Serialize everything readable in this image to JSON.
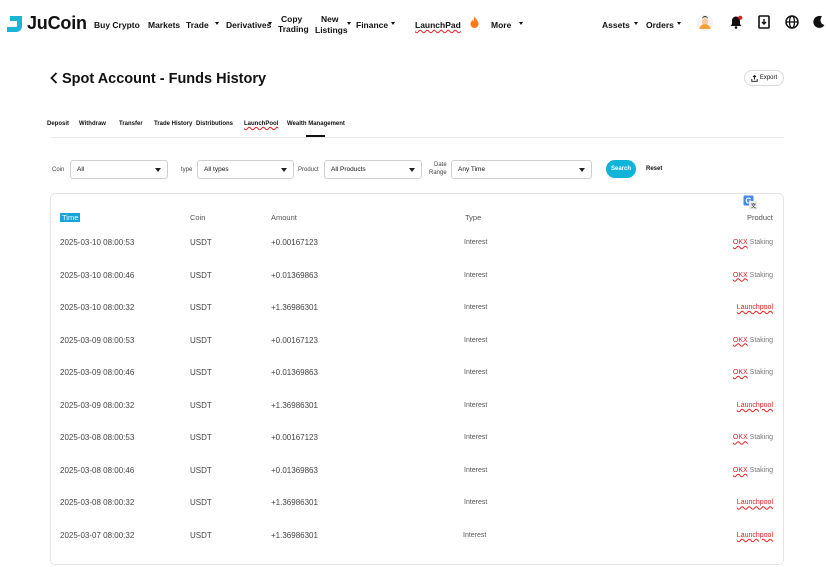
{
  "header": {
    "brand": "JuCoin",
    "nav": {
      "buy_crypto": "Buy Crypto",
      "markets": "Markets",
      "trade": "Trade",
      "derivatives": "Derivatives",
      "copy_trading_1": "Copy",
      "copy_trading_2": "Trading",
      "new_listings_1": "New",
      "new_listings_2": "Listings",
      "finance": "Finance",
      "launchpad": "LaunchPad",
      "more": "More",
      "assets": "Assets",
      "orders": "Orders"
    },
    "icons": [
      "avatar",
      "bell-icon",
      "download-icon",
      "globe-icon",
      "moon-icon"
    ]
  },
  "title": {
    "text": "Spot Account  - Funds History",
    "export_label": "Export"
  },
  "tabs": [
    "Deposit",
    "Withdraw",
    "Transfer",
    "Trade History",
    "Distributions",
    "LaunchPool",
    "Wealth Management"
  ],
  "active_tab": "Wealth Management",
  "filters": {
    "coin_label": "Coin",
    "coin_value": "All",
    "type_label": "type",
    "type_value": "All types",
    "product_label": "Product",
    "product_value": "All Products",
    "date_label_1": "Date",
    "date_label_2": "Range",
    "date_value": "Any Time",
    "search_label": "Search",
    "reset_label": "Reset"
  },
  "table": {
    "columns": {
      "time": "Time",
      "coin": "Coin",
      "amount": "Amount",
      "type": "Type",
      "product": "Product"
    },
    "rows": [
      {
        "time": "2025-03-10 08:00:53",
        "coin": "USDT",
        "amount": "+0.00167123",
        "type": "Interest",
        "product_prefix": "OKX",
        "product": "Staking",
        "launch": false
      },
      {
        "time": "2025-03-10 08:00:46",
        "coin": "USDT",
        "amount": "+0.01369863",
        "type": "Interest",
        "product_prefix": "OKX",
        "product": "Staking",
        "launch": false
      },
      {
        "time": "2025-03-10 08:00:32",
        "coin": "USDT",
        "amount": "+1.36986301",
        "type": "Interest",
        "product_prefix": "",
        "product": "Launchpool",
        "launch": true
      },
      {
        "time": "2025-03-09 08:00:53",
        "coin": "USDT",
        "amount": "+0.00167123",
        "type": "Interest",
        "product_prefix": "OKX",
        "product": "Staking",
        "launch": false
      },
      {
        "time": "2025-03-09 08:00:46",
        "coin": "USDT",
        "amount": "+0.01369863",
        "type": "Interest",
        "product_prefix": "OKX",
        "product": "Staking",
        "launch": false
      },
      {
        "time": "2025-03-09 08:00:32",
        "coin": "USDT",
        "amount": "+1.36986301",
        "type": "Interest",
        "product_prefix": "",
        "product": "Launchpool",
        "launch": true
      },
      {
        "time": "2025-03-08 08:00:53",
        "coin": "USDT",
        "amount": "+0.00167123",
        "type": "Interest",
        "product_prefix": "OKX",
        "product": "Staking",
        "launch": false
      },
      {
        "time": "2025-03-08 08:00:46",
        "coin": "USDT",
        "amount": "+0.01369863",
        "type": "Interest",
        "product_prefix": "OKX",
        "product": "Staking",
        "launch": false
      },
      {
        "time": "2025-03-08 08:00:32",
        "coin": "USDT",
        "amount": "+1.36986301",
        "type": "Interest",
        "product_prefix": "",
        "product": "Launchpool",
        "launch": true
      },
      {
        "time": "2025-03-07 08:00:32",
        "coin": "USDT",
        "amount": "+1.36986301",
        "type": "Interest",
        "product_prefix": "",
        "product": "Launchpool",
        "launch": true
      }
    ]
  },
  "colors": {
    "brand": "#1ab4d7",
    "accent": "#10b4d8",
    "squiggle": "#e02020"
  }
}
